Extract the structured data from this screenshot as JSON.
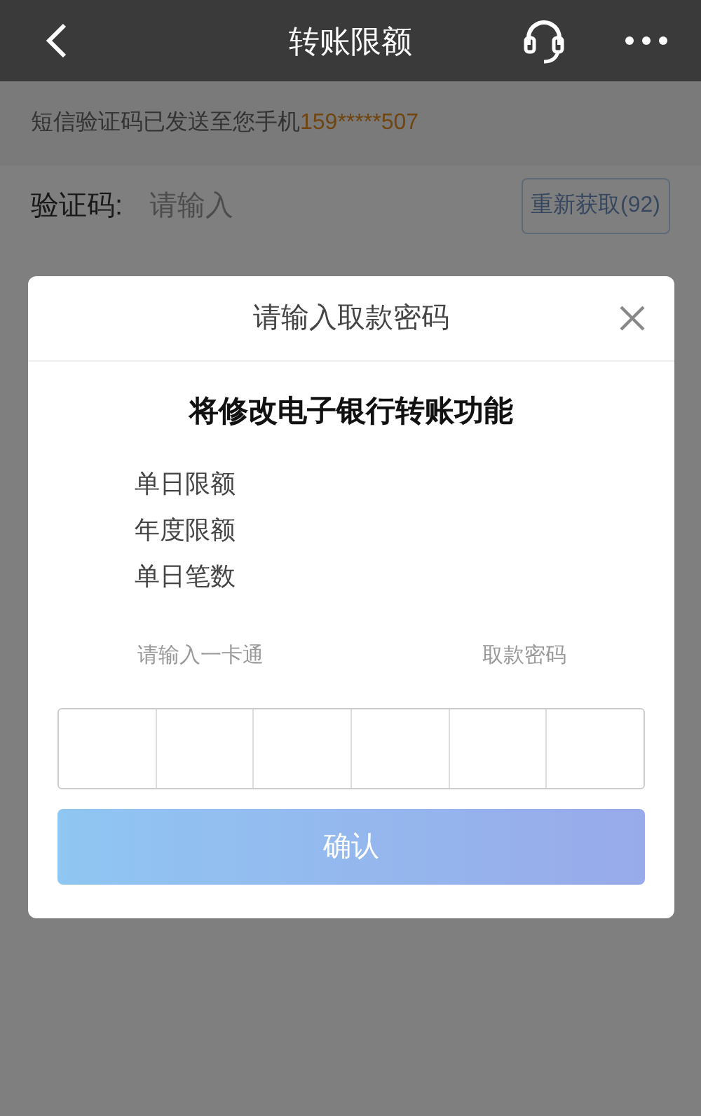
{
  "header": {
    "title": "转账限额"
  },
  "notice": {
    "text": "短信验证码已发送至您手机",
    "phone": "159*****507"
  },
  "code_field": {
    "label": "验证码:",
    "placeholder": "请输入"
  },
  "resend_button": {
    "label": "重新获取(92)",
    "disabled": true
  },
  "dialog": {
    "title": "请输入取款密码",
    "heading": "将修改电子银行转账功能",
    "items": [
      "单日限额",
      "年度限额",
      "单日笔数"
    ],
    "hint_left": "请输入一卡通",
    "hint_right": "取款密码",
    "pin_boxes": [
      {
        "filled": false
      },
      {
        "filled": false
      },
      {
        "filled": false
      },
      {
        "filled": false
      },
      {
        "filled": false
      },
      {
        "filled": false
      }
    ],
    "confirm_button": {
      "label": "确认",
      "disabled": true
    }
  }
}
